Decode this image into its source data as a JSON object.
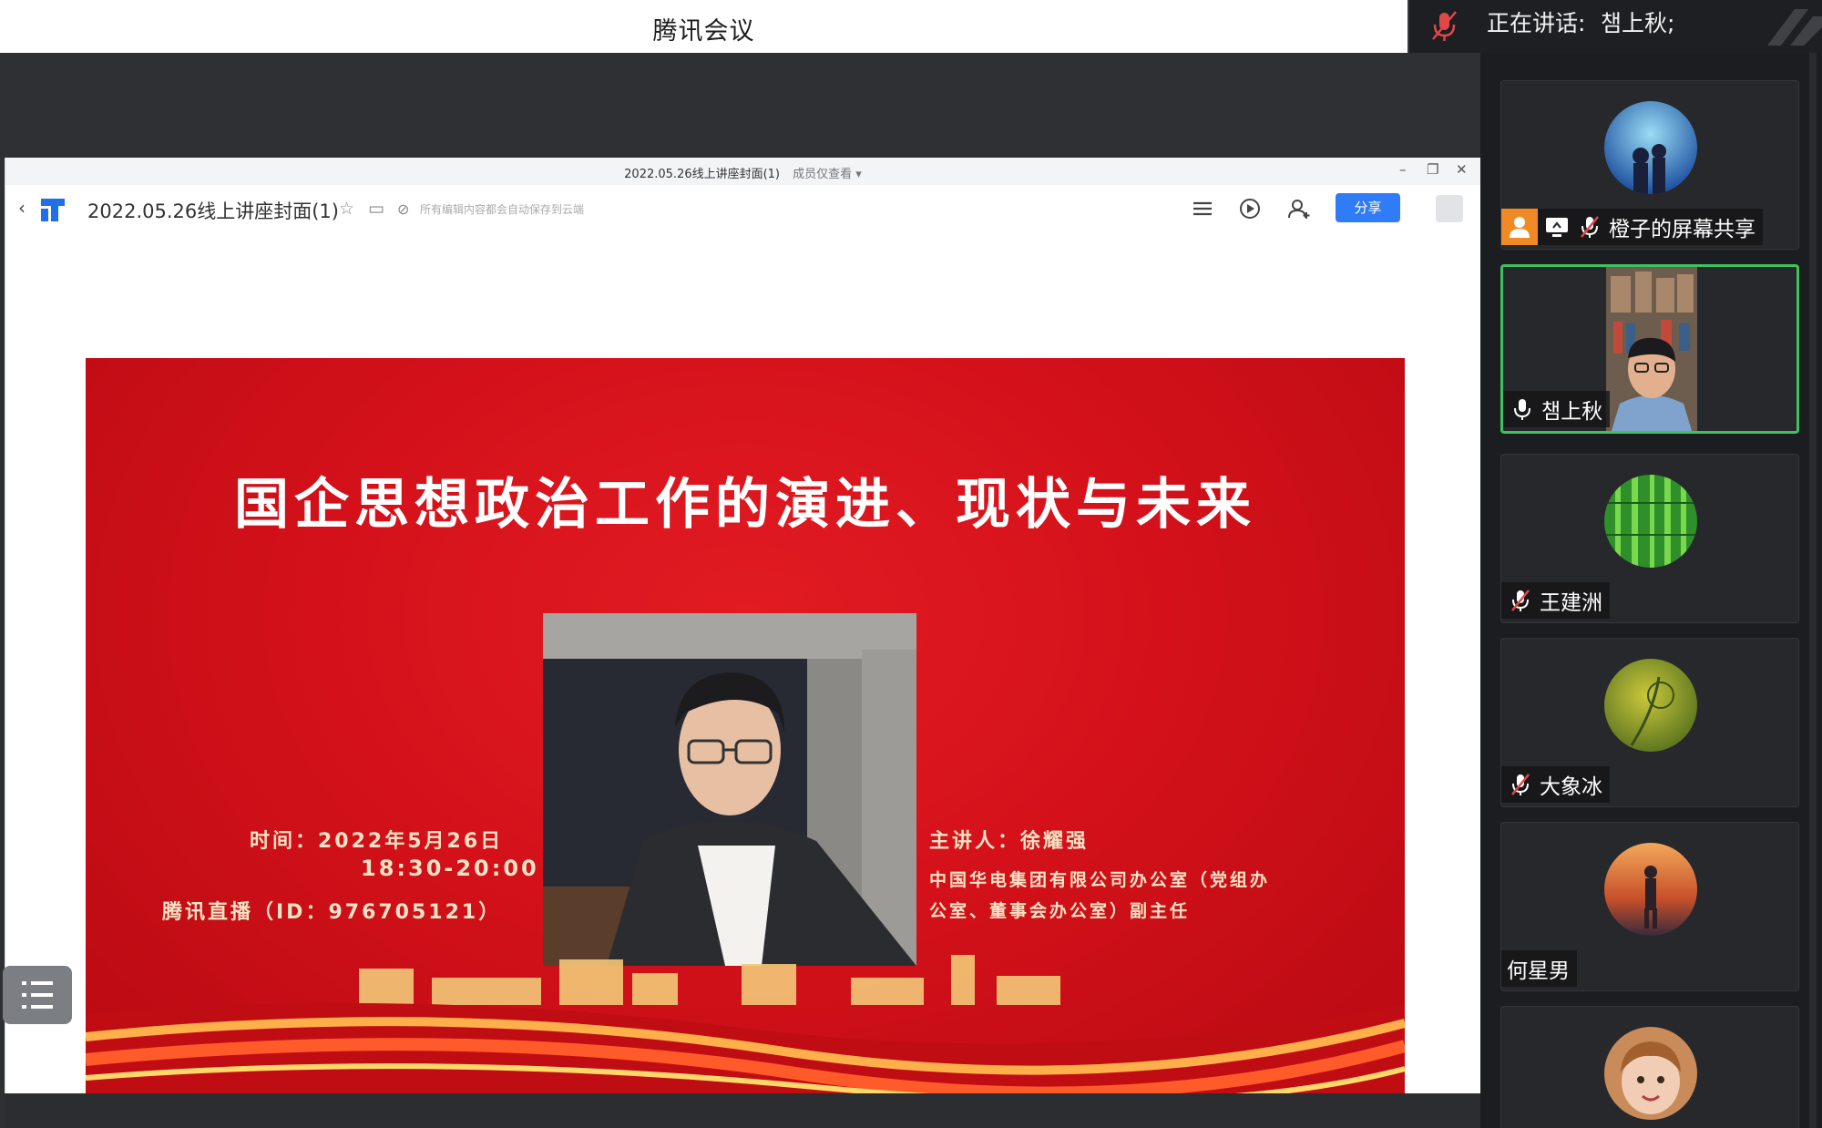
{
  "app": {
    "title": "腾讯会议",
    "speaking_label": "正在讲话:",
    "speaking_name": "챔上秋;"
  },
  "shared_window": {
    "title": "2022.05.26线上讲座封面(1)",
    "subtitle": "成员仅查看 ▾",
    "doc_name": "2022.05.26线上讲座封面(1)",
    "status": "所有编辑内容都会自动保存到云端",
    "share_label": "分享"
  },
  "slide": {
    "title": "国企思想政治工作的演进、现状与未来",
    "time_label": "时间：2022年5月26日",
    "time_range": "18:30-20:00",
    "live_label": "腾讯直播（ID：976705121）",
    "speaker_label": "主讲人：徐耀强",
    "speaker_title_1": "中国华电集团有限公司办公室（党组办",
    "speaker_title_2": "公室、董事会办公室）副主任"
  },
  "participants": [
    {
      "name": "橙子的屏幕共享",
      "avatar": "starry-couple-avatar",
      "mic": "muted",
      "screen_share": true
    },
    {
      "name": "챔上秋",
      "avatar": "video-feed",
      "mic": "on",
      "active": true
    },
    {
      "name": "王建洲",
      "avatar": "bamboo-avatar",
      "mic": "muted"
    },
    {
      "name": "大象冰",
      "avatar": "leaf-avatar",
      "mic": "muted"
    },
    {
      "name": "何星男",
      "avatar": "figure-sunset-avatar",
      "mic": "none"
    },
    {
      "name": "",
      "avatar": "child-avatar",
      "mic": "none"
    }
  ],
  "colors": {
    "slide_red": "#d4111a",
    "active_border": "#3cc25f",
    "share_button": "#2f7cf6"
  }
}
